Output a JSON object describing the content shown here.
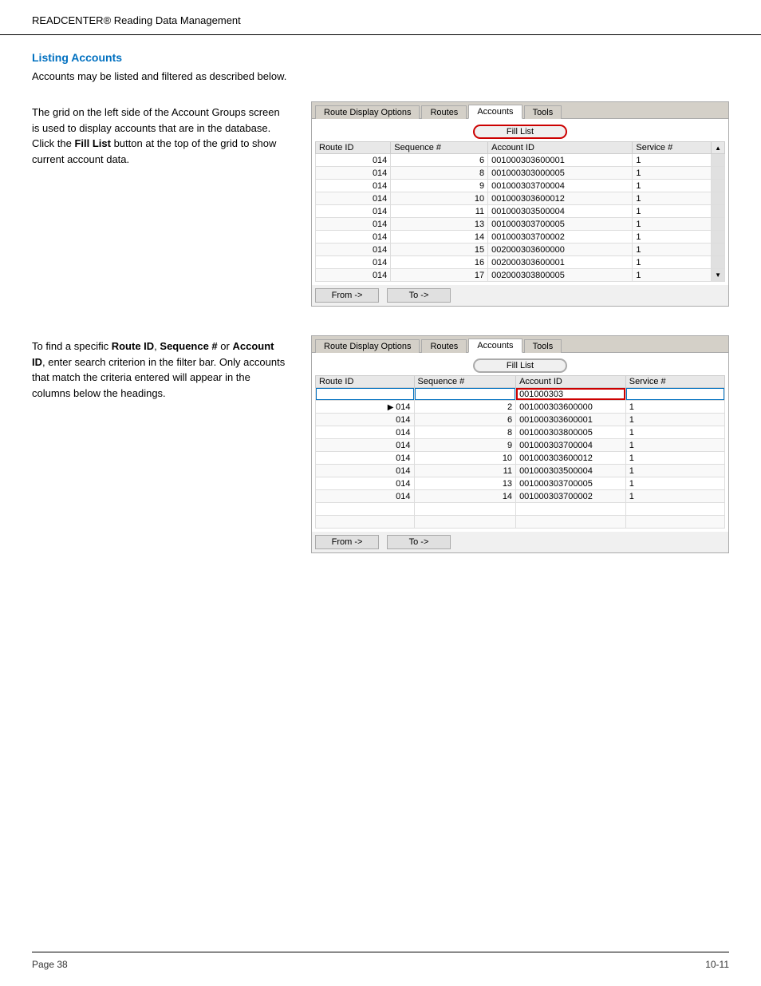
{
  "header": {
    "title": "READCENTER",
    "trademark": "®",
    "subtitle": " Reading Data Management"
  },
  "section": {
    "heading": "Listing Accounts",
    "intro": "Accounts may be listed and filtered as described below."
  },
  "example1": {
    "description_parts": [
      "The grid on the left side of the Account Groups screen is used to display accounts that are in the database. Click the ",
      "Fill List",
      " button at the top of the grid to show current account data."
    ],
    "tabs": [
      "Route Display Options",
      "Routes",
      "Accounts",
      "Tools"
    ],
    "active_tab": "Accounts",
    "fill_list_label": "Fill List",
    "columns": [
      "Route ID",
      "Sequence #",
      "Account ID",
      "Service #"
    ],
    "rows": [
      [
        "014",
        "6",
        "001000303600001",
        "1"
      ],
      [
        "014",
        "8",
        "001000303000005",
        "1"
      ],
      [
        "014",
        "9",
        "001000303700004",
        "1"
      ],
      [
        "014",
        "10",
        "001000303600012",
        "1"
      ],
      [
        "014",
        "11",
        "001000303500004",
        "1"
      ],
      [
        "014",
        "13",
        "001000303700005",
        "1"
      ],
      [
        "014",
        "14",
        "001000303700002",
        "1"
      ],
      [
        "014",
        "15",
        "002000303600000",
        "1"
      ],
      [
        "014",
        "16",
        "002000303600001",
        "1"
      ],
      [
        "014",
        "17",
        "002000303800005",
        "1"
      ]
    ],
    "from_btn": "From ->",
    "to_btn": "To ->"
  },
  "example2": {
    "description_parts": [
      "To find a specific ",
      "Route ID",
      ", ",
      "Sequence #",
      " or ",
      "Account ID",
      ", enter search criterion in the filter bar. Only accounts that match the criteria entered will appear in the columns below the headings."
    ],
    "tabs": [
      "Route Display Options",
      "Routes",
      "Accounts",
      "Tools"
    ],
    "active_tab": "Accounts",
    "fill_list_label": "Fill List",
    "columns": [
      "Route ID",
      "Sequence #",
      "Account ID",
      "Service #"
    ],
    "filter_values": [
      "",
      "",
      "001000303",
      ""
    ],
    "rows": [
      [
        "014",
        "2",
        "001000303600000",
        "1"
      ],
      [
        "014",
        "6",
        "001000303600001",
        "1"
      ],
      [
        "014",
        "8",
        "001000303800005",
        "1"
      ],
      [
        "014",
        "9",
        "001000303700004",
        "1"
      ],
      [
        "014",
        "10",
        "001000303600012",
        "1"
      ],
      [
        "014",
        "11",
        "001000303500004",
        "1"
      ],
      [
        "014",
        "13",
        "001000303700005",
        "1"
      ],
      [
        "014",
        "14",
        "001000303700002",
        "1"
      ]
    ],
    "selected_row": 0,
    "from_btn": "From ->",
    "to_btn": "To ->"
  },
  "footer": {
    "left": "Page 38",
    "right": "10-11"
  }
}
